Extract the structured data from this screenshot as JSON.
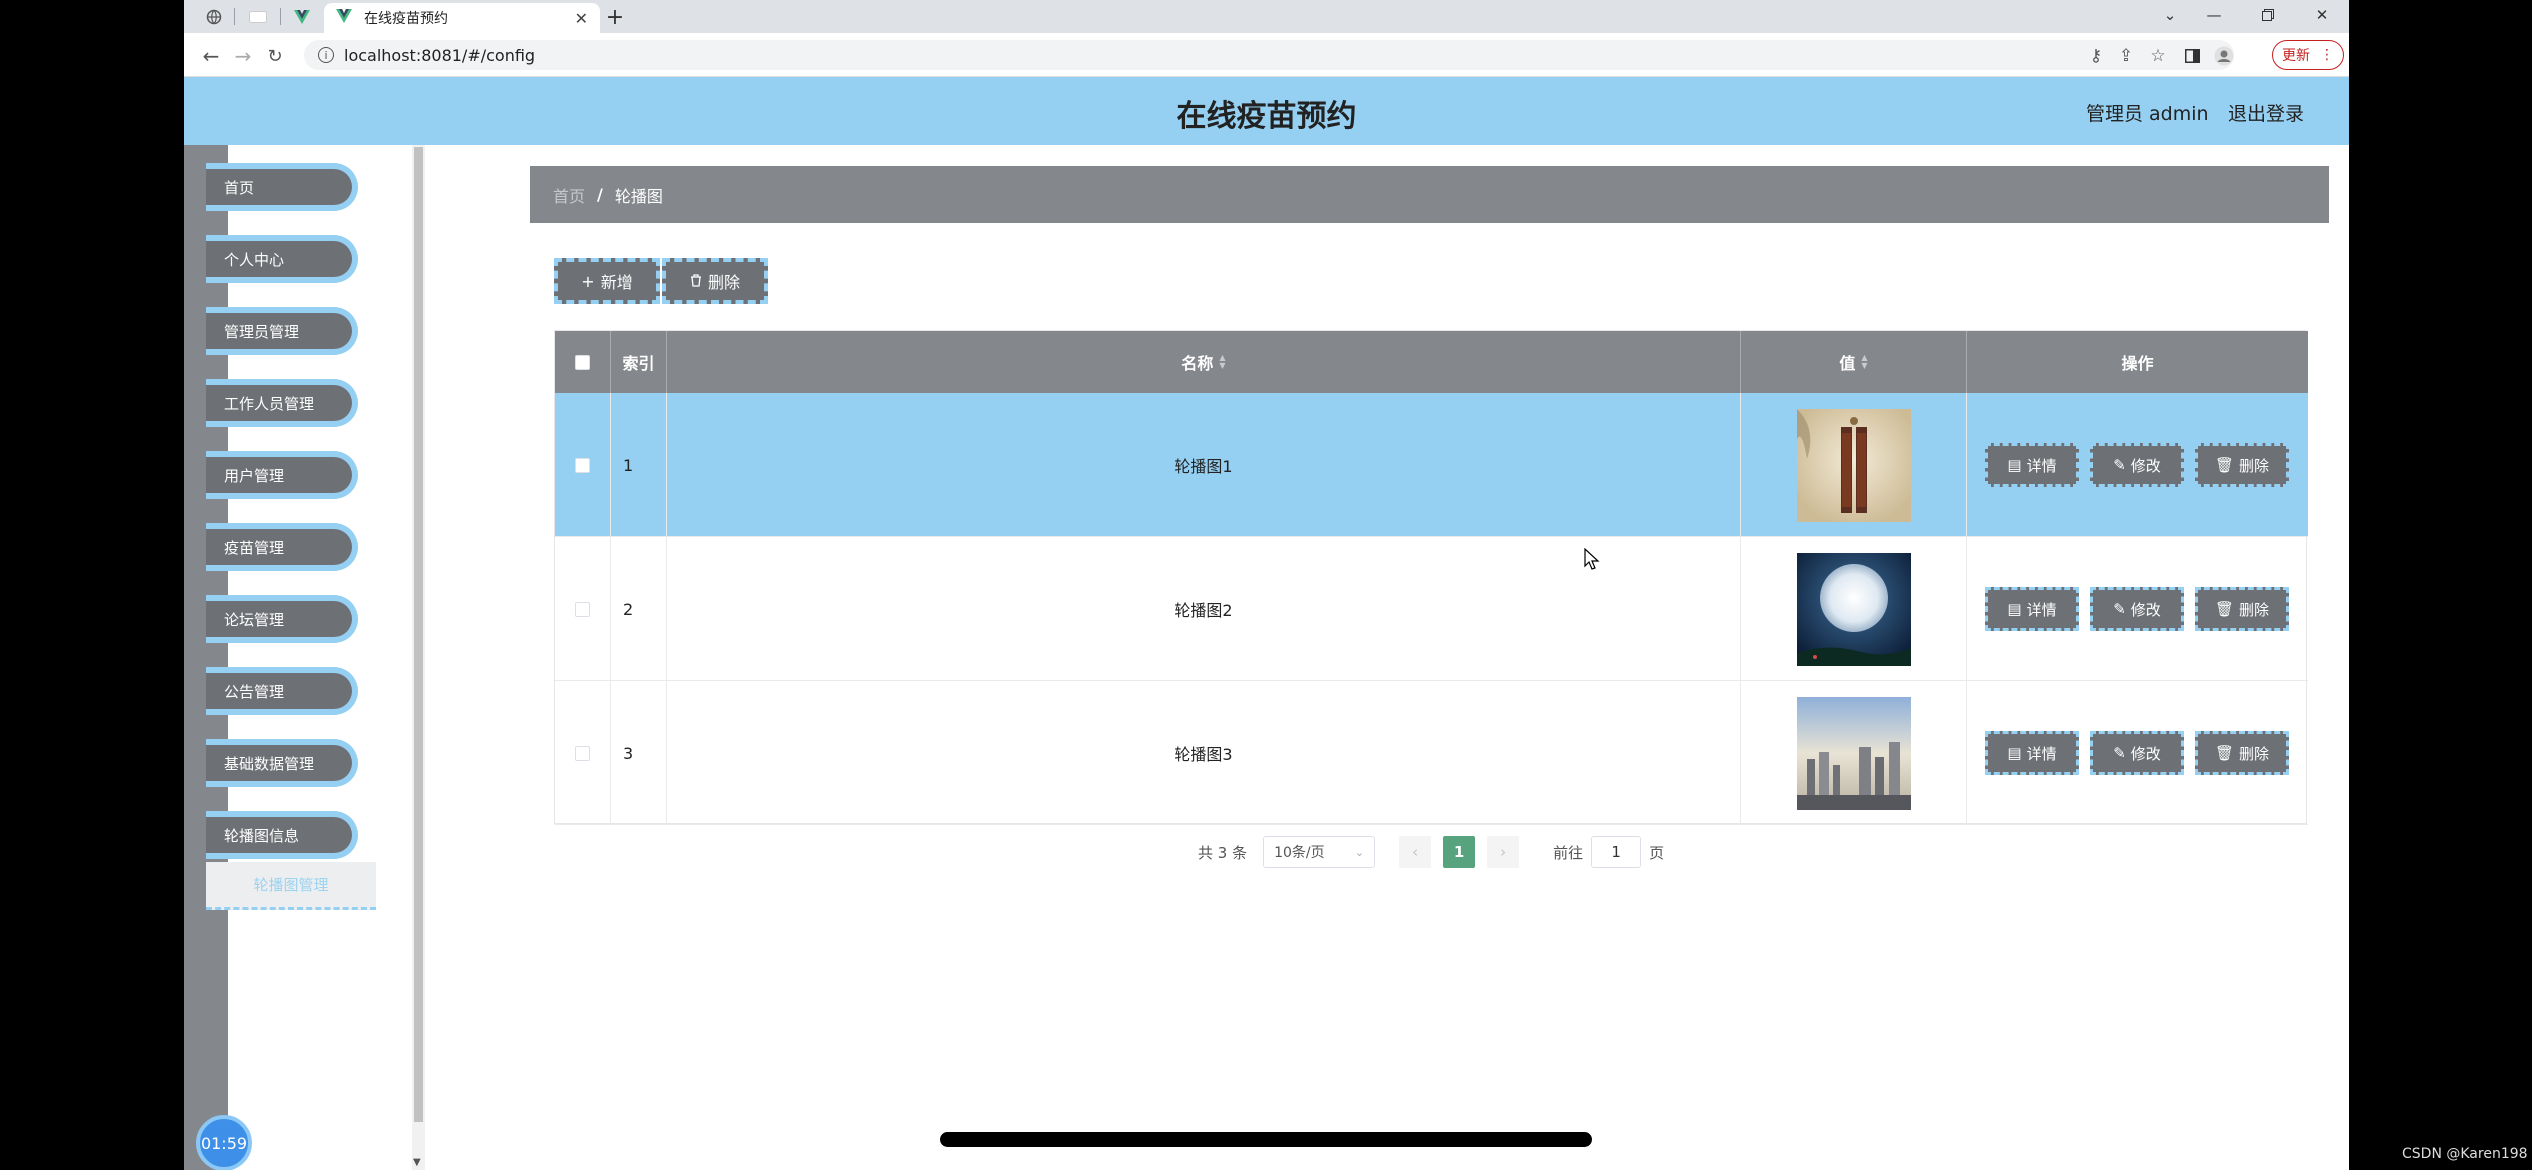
{
  "browser": {
    "tab_title": "在线疫苗预约",
    "url": "localhost:8081/#/config",
    "update_label": "更新"
  },
  "header": {
    "title": "在线疫苗预约",
    "user": "管理员 admin",
    "logout": "退出登录"
  },
  "sidebar": {
    "items": [
      "首页",
      "个人中心",
      "管理员管理",
      "工作人员管理",
      "用户管理",
      "疫苗管理",
      "论坛管理",
      "公告管理",
      "基础数据管理",
      "轮播图信息"
    ],
    "sub_item": "轮播图管理",
    "clock": "01:59"
  },
  "breadcrumb": {
    "home": "首页",
    "sep": "/",
    "current": "轮播图"
  },
  "toolbar": {
    "add": "新增",
    "delete": "删除"
  },
  "table": {
    "headers": {
      "index": "索引",
      "name": "名称",
      "value": "值",
      "actions": "操作"
    },
    "rows": [
      {
        "index": "1",
        "name": "轮播图1",
        "image": "scroll-painting"
      },
      {
        "index": "2",
        "name": "轮播图2",
        "image": "moon-night"
      },
      {
        "index": "3",
        "name": "轮播图3",
        "image": "city-skyline"
      }
    ],
    "actions": {
      "detail": "详情",
      "edit": "修改",
      "delete": "删除"
    }
  },
  "pagination": {
    "total": "共 3 条",
    "page_size": "10条/页",
    "current": "1",
    "goto_label": "前往",
    "goto_value": "1",
    "page_suffix": "页"
  },
  "watermark": "CSDN @Karen198",
  "colors": {
    "accent": "#95d0f2",
    "gray": "#84878c",
    "button": "#6d7075",
    "page_active": "#56a37e"
  }
}
